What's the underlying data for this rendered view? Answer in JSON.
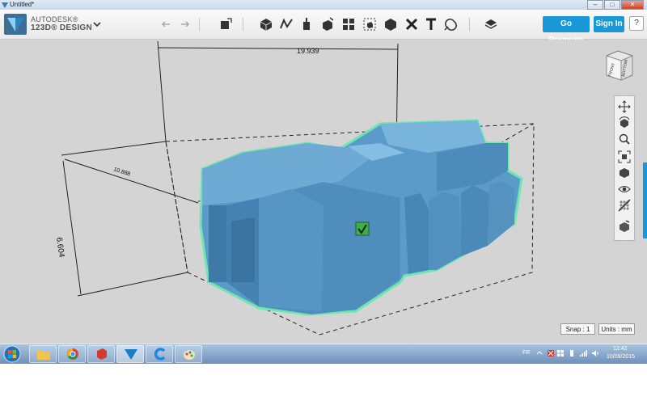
{
  "window": {
    "title": "Untitled*",
    "minimize": "–",
    "maximize": "□",
    "close": "✕"
  },
  "brand": {
    "line1": "AUTODESK®",
    "line2": "123D® DESIGN"
  },
  "header": {
    "premium_label": "Go Premium",
    "signin_label": "Sign In",
    "help_label": "?"
  },
  "toolbar_icons": [
    "undo-icon",
    "redo-icon",
    "transform-icon",
    "primitives-icon",
    "sketch-icon",
    "construct-icon",
    "modify-icon",
    "pattern-icon",
    "grouping-icon",
    "combine-icon",
    "measure-icon",
    "text-icon",
    "snap-icon",
    "material-icon"
  ],
  "dimensions": {
    "width": "19.939",
    "depth": "10.888",
    "height": "6.604"
  },
  "viewcube": {
    "front": "FRONT",
    "bottom": "BOTTOM"
  },
  "status": {
    "snap": "Snap : 1",
    "units": "Units : mm"
  },
  "taskbar": {
    "lang": "FR",
    "time": "12:42",
    "date": "10/09/2015"
  },
  "colors": {
    "accent": "#1997d6",
    "model": "#5b9bc9",
    "selection": "#6ee6b0"
  }
}
